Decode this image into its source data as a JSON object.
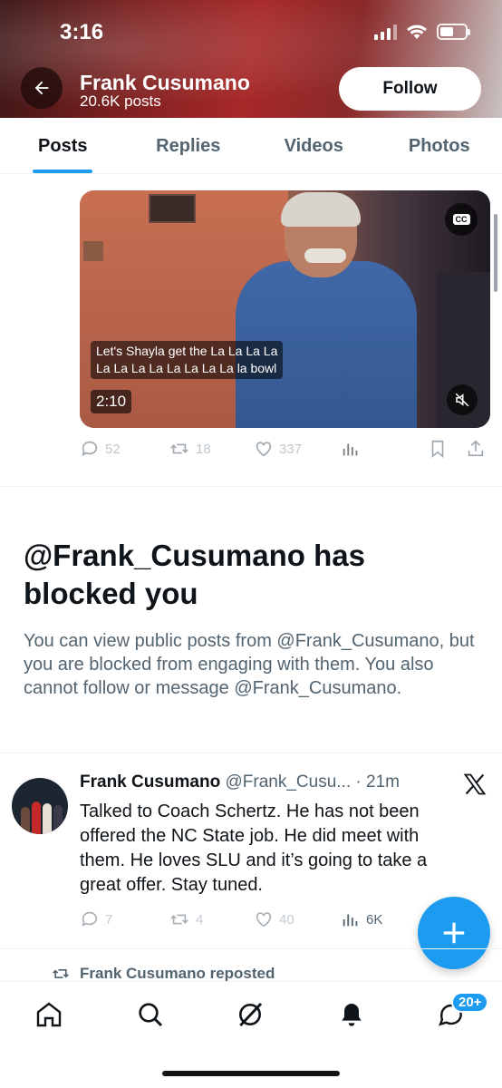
{
  "status_bar": {
    "time": "3:16"
  },
  "profile": {
    "name": "Frank Cusumano",
    "posts_count": "20.6K posts",
    "follow_label": "Follow"
  },
  "tabs": [
    {
      "label": "Posts",
      "active": true
    },
    {
      "label": "Replies",
      "active": false
    },
    {
      "label": "Videos",
      "active": false
    },
    {
      "label": "Photos",
      "active": false
    }
  ],
  "video_post": {
    "caption_line1": "Let's Shayla get the La La La La",
    "caption_line2": "La La La La La La La La la bowl",
    "duration": "2:10",
    "replies": "52",
    "reposts": "18",
    "likes": "337"
  },
  "blocked": {
    "title": "@Frank_Cusumano has blocked you",
    "body": "You can view public posts from @Frank_Cusumano, but you are blocked from engaging with them. You also cannot follow or message @Frank_Cusumano."
  },
  "tweet": {
    "name": "Frank Cusumano",
    "handle": "@Frank_Cusu...",
    "time": "· 21m",
    "text": "Talked to Coach Schertz. He has not been offered the NC State job. He did meet with them. He loves SLU and it’s going to take a great offer. Stay tuned.",
    "replies": "7",
    "reposts": "4",
    "likes": "40",
    "views": "6K"
  },
  "repost_notice": "Frank Cusumano reposted",
  "nav": {
    "notifications_badge": "20+"
  },
  "colors": {
    "accent": "#1d9bf0",
    "text_primary": "#0f1419",
    "text_secondary": "#536471"
  }
}
